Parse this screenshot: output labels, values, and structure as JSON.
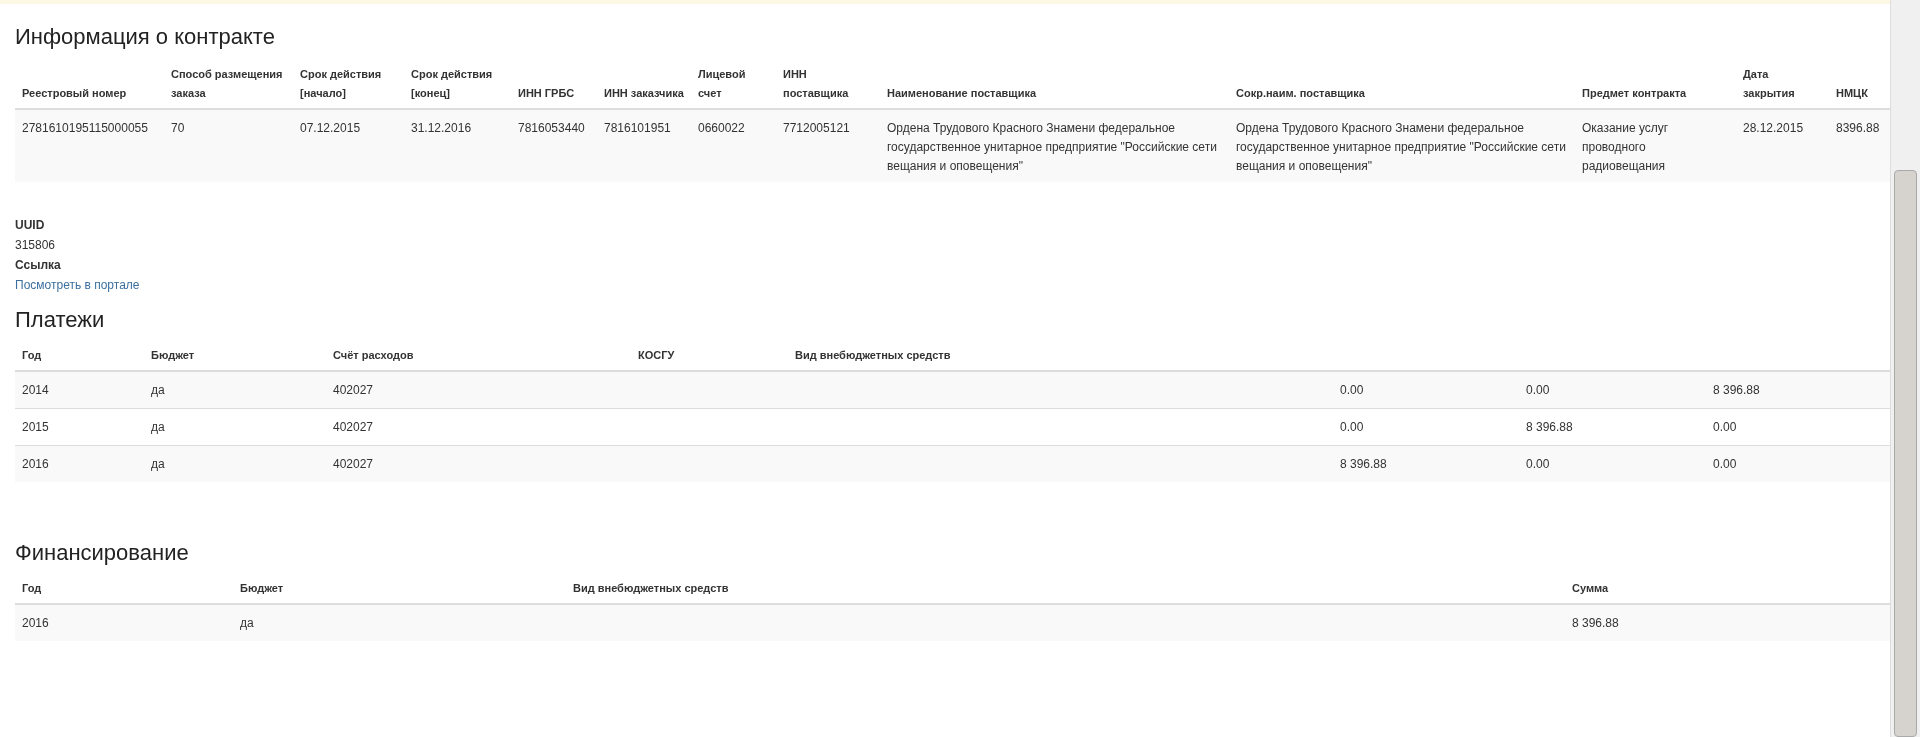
{
  "contract": {
    "title": "Информация о контракте",
    "columns": [
      "Реестровый номер",
      "Способ размещения заказа",
      "Срок действия [начало]",
      "Срок действия [конец]",
      "ИНН ГРБС",
      "ИНН заказчика",
      "Лицевой счет",
      "ИНН поставщика",
      "Наименование поставщика",
      "Сокр.наим. поставщика",
      "Предмет контракта",
      "Дата закрытия",
      "НМЦК"
    ],
    "rows": [
      [
        "2781610195115000055",
        "70",
        "07.12.2015",
        "31.12.2016",
        "7816053440",
        "7816101951",
        "0660022",
        "7712005121",
        "Ордена Трудового Красного Знамени федеральное государственное унитарное предприятие \"Российские сети вещания и оповещения\"",
        "Ордена Трудового Красного Знамени федеральное государственное унитарное предприятие \"Российские сети вещания и оповещения\"",
        "Оказание услуг проводного радиовещания",
        "28.12.2015",
        "8396.88"
      ]
    ]
  },
  "details": [
    {
      "label": "UUID",
      "value": "315806"
    },
    {
      "label": "Ссылка",
      "link": "Посмотреть в портале"
    }
  ],
  "payments": {
    "title": "Платежи",
    "columns": [
      "Год",
      "Бюджет",
      "Счёт расходов",
      "КОСГУ",
      "Вид внебюджетных средств"
    ],
    "rows": [
      [
        "2014",
        "да",
        "402027",
        "",
        "",
        "0.00",
        "0.00",
        "8 396.88"
      ],
      [
        "2015",
        "да",
        "402027",
        "",
        "",
        "0.00",
        "8 396.88",
        "0.00"
      ],
      [
        "2016",
        "да",
        "402027",
        "",
        "",
        "8 396.88",
        "0.00",
        "0.00"
      ]
    ]
  },
  "financing": {
    "title": "Финансирование",
    "columns": [
      "Год",
      "Бюджет",
      "Вид внебюджетных средств",
      "Сумма"
    ],
    "rows": [
      [
        "2016",
        "да",
        "",
        "8 396.88"
      ]
    ]
  }
}
